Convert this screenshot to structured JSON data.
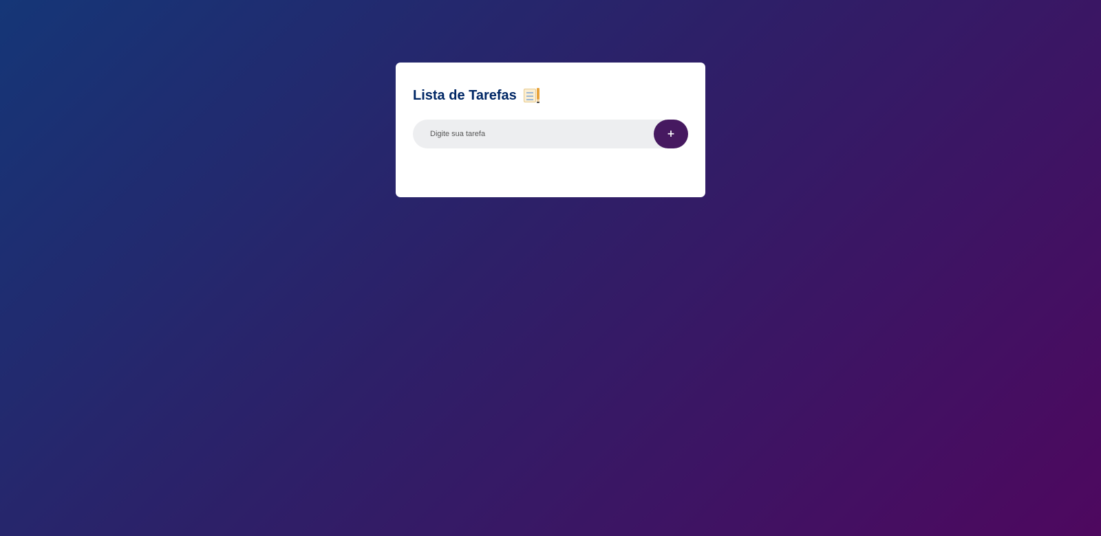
{
  "app": {
    "title": "Lista de Tarefas",
    "title_icon": "notepad-checklist-icon"
  },
  "task_input": {
    "placeholder": "Digite sua tarefa",
    "value": ""
  },
  "add_button": {
    "label": "+"
  },
  "tasks": [],
  "colors": {
    "background_gradient_start": "#153677",
    "background_gradient_end": "#4e085f",
    "card_background": "#ffffff",
    "title_color": "#002765",
    "input_background": "#edeef0",
    "button_color": "#461960"
  }
}
